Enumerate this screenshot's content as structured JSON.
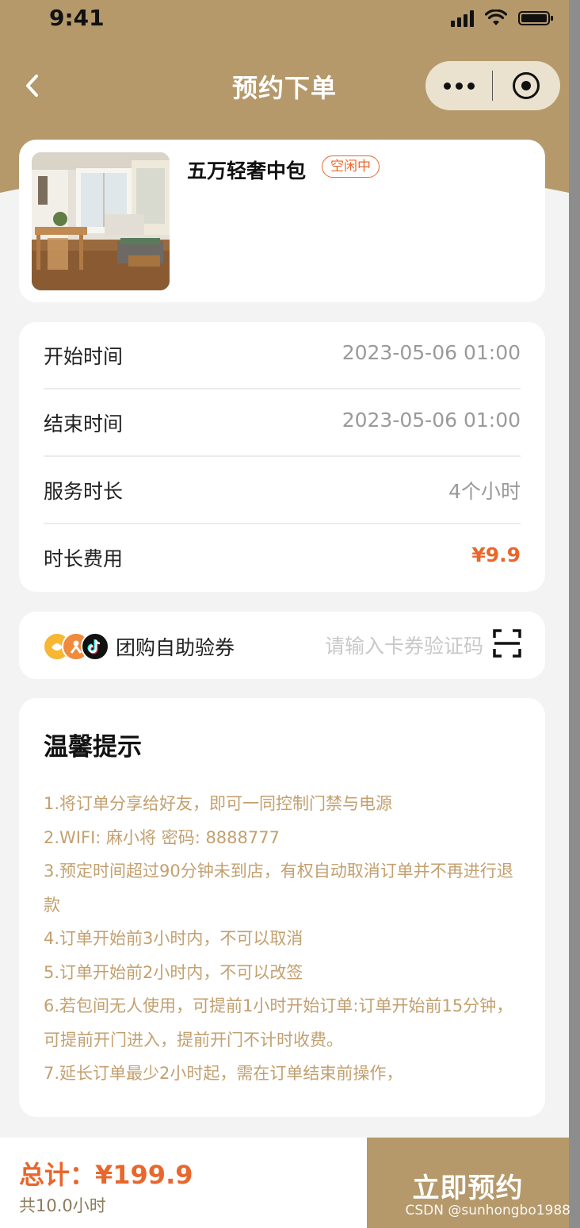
{
  "status_bar": {
    "time": "9:41"
  },
  "nav": {
    "title": "预约下单"
  },
  "room": {
    "name": "五万轻奢中包",
    "status": "空闲中"
  },
  "booking": {
    "rows": [
      {
        "label": "开始时间",
        "value": "2023-05-06 01:00"
      },
      {
        "label": "结束时间",
        "value": "2023-05-06 01:00"
      },
      {
        "label": "服务时长",
        "value": "4个小时"
      },
      {
        "label": "时长费用",
        "value": "¥9.9"
      }
    ]
  },
  "voucher": {
    "label": "团购自助验券",
    "placeholder": "请输入卡券验证码",
    "platform_icons": [
      "meituan-icon",
      "dianping-icon",
      "douyin-icon"
    ]
  },
  "tips": {
    "title": "温馨提示",
    "items": [
      "1.将订单分享给好友，即可一同控制门禁与电源",
      "2.WIFI: 麻小将 密码: 8888777",
      "3.预定时间超过90分钟未到店，有权自动取消订单并不再进行退款",
      "4.订单开始前3小时内，不可以取消",
      "5.订单开始前2小时内，不可以改签",
      "6.若包间无人使用，可提前1小时开始订单:订单开始前15分钟，可提前开门进入，提前开门不计时收费。",
      "7.延长订单最少2小时起，需在订单结束前操作，"
    ]
  },
  "footer": {
    "total": "总计：¥199.9",
    "hours": "共10.0小时",
    "book_label": "立即预约",
    "watermark": "CSDN @sunhongbo1988"
  },
  "colors": {
    "brand": "#b5996b",
    "accent": "#e8672c",
    "tip_text": "#c3a06f"
  }
}
